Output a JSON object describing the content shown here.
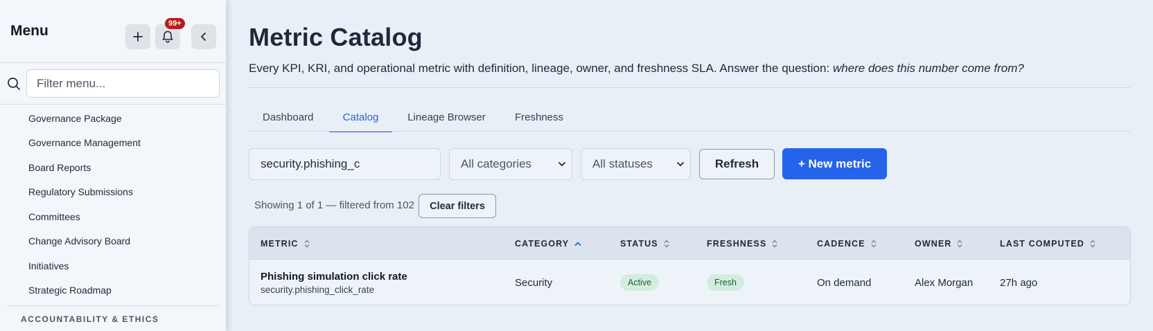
{
  "sidebar": {
    "title": "Menu",
    "notification_count": "99+",
    "search_placeholder": "Filter menu...",
    "items": [
      {
        "label": "Governance Package"
      },
      {
        "label": "Governance Management"
      },
      {
        "label": "Board Reports"
      },
      {
        "label": "Regulatory Submissions"
      },
      {
        "label": "Committees"
      },
      {
        "label": "Change Advisory Board"
      },
      {
        "label": "Initiatives"
      },
      {
        "label": "Strategic Roadmap"
      }
    ],
    "section_heading": "ACCOUNTABILITY & ETHICS"
  },
  "page": {
    "title": "Metric Catalog",
    "subtitle": "Every KPI, KRI, and operational metric with definition, lineage, owner, and freshness SLA. Answer the question:",
    "subtitle_question": "where does this number come from?"
  },
  "tabs": [
    {
      "label": "Dashboard",
      "active": false
    },
    {
      "label": "Catalog",
      "active": true
    },
    {
      "label": "Lineage Browser",
      "active": false
    },
    {
      "label": "Freshness",
      "active": false
    }
  ],
  "filters": {
    "search_value": "security.phishing_c",
    "category_value": "All categories",
    "status_value": "All statuses",
    "refresh_label": "Refresh",
    "new_metric_label": "+ New metric"
  },
  "results": {
    "showing_text": "Showing 1 of 1 — filtered from 102",
    "clear_filters_label": "Clear filters"
  },
  "table": {
    "columns": [
      {
        "label": "METRIC",
        "sort": "none"
      },
      {
        "label": "CATEGORY",
        "sort": "asc"
      },
      {
        "label": "STATUS",
        "sort": "none"
      },
      {
        "label": "FRESHNESS",
        "sort": "none"
      },
      {
        "label": "CADENCE",
        "sort": "none"
      },
      {
        "label": "OWNER",
        "sort": "none"
      },
      {
        "label": "LAST COMPUTED",
        "sort": "none"
      }
    ],
    "rows": [
      {
        "metric_name": "Phishing simulation click rate",
        "metric_key": "security.phishing_click_rate",
        "category": "Security",
        "status": "Active",
        "freshness": "Fresh",
        "cadence": "On demand",
        "owner": "Alex Morgan",
        "last_computed": "27h ago"
      }
    ]
  },
  "colors": {
    "accent": "#2563eb",
    "badge": "#b91c1c",
    "pill_bg": "#d4ece0",
    "pill_text": "#166534"
  },
  "icons": [
    "plus-icon",
    "bell-icon",
    "chevron-left-icon",
    "search-icon",
    "chevron-down-icon",
    "sort-icon",
    "sort-asc-icon"
  ]
}
